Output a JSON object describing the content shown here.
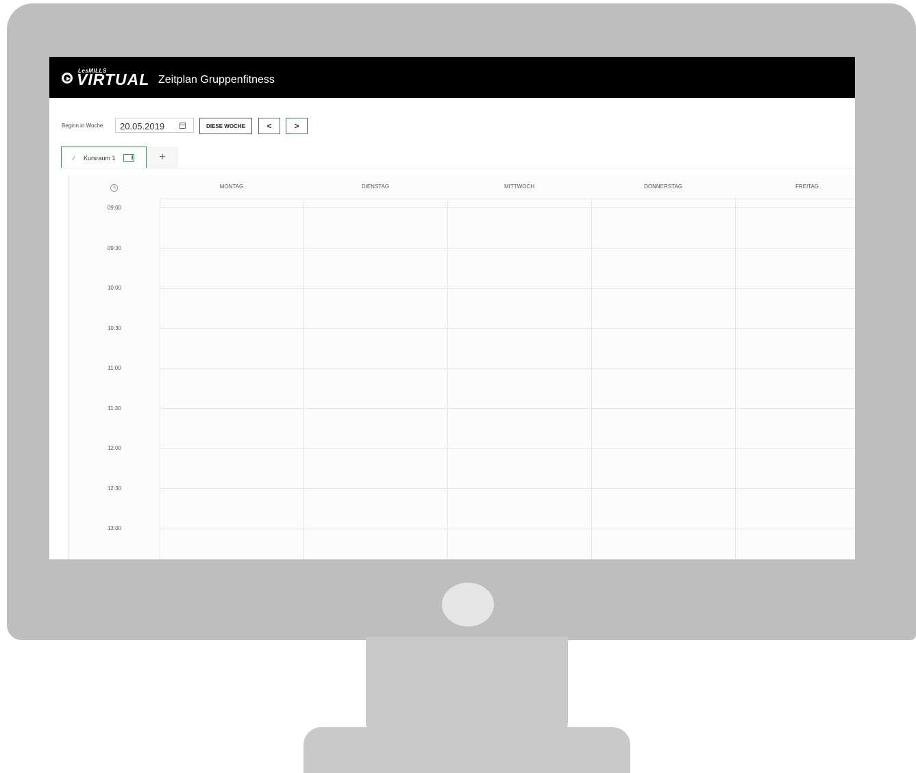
{
  "app": {
    "logo_brand": "LesMILLS",
    "logo_word": "VIRTUAL",
    "title": "Zeitplan Gruppenfitness"
  },
  "toolbar": {
    "week_label": "Beginn in Woche",
    "date_value": "20.05.2019",
    "this_week_label": "DIESE WOCHE",
    "prev_label": "<",
    "next_label": ">"
  },
  "tabs": [
    {
      "label": "Kursraum 1",
      "active": true
    }
  ],
  "add_tab_label": "+",
  "schedule": {
    "days": [
      "MONTAG",
      "DIENSTAG",
      "MITTWOCH",
      "DONNERSTAG",
      "FREITAG"
    ],
    "times": [
      "09:00",
      "09:30",
      "10:00",
      "10:30",
      "11:00",
      "11:30",
      "12:00",
      "12:30",
      "13:00"
    ]
  },
  "colors": {
    "accent": "#2e9b57",
    "header_bg": "#000000",
    "monitor": "#bebebe"
  }
}
